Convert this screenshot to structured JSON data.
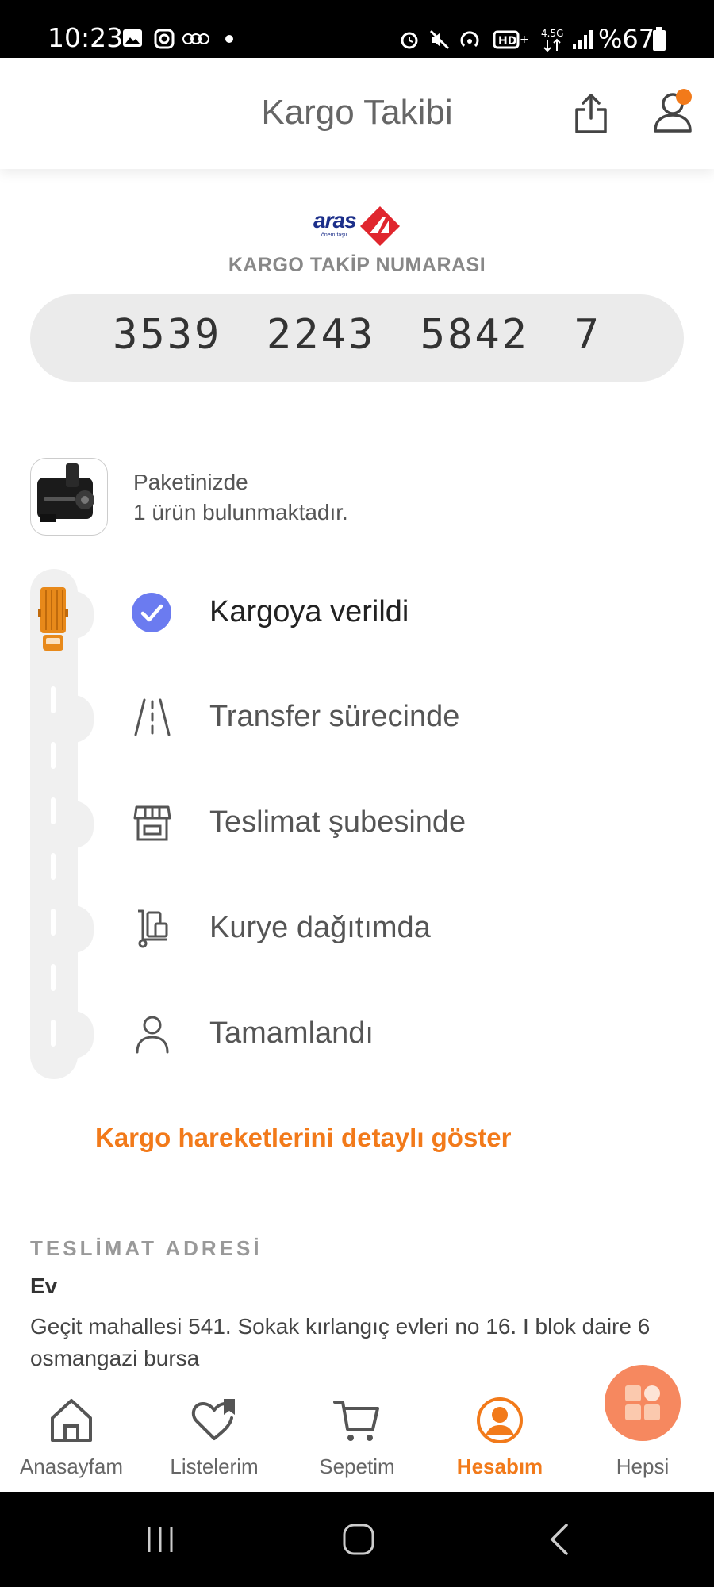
{
  "status_bar": {
    "time": "10:23",
    "battery": "%67",
    "network": "4.5G"
  },
  "header": {
    "title": "Kargo Takibi"
  },
  "carrier": {
    "logo_text": "aras",
    "logo_tagline": "önem taşır",
    "tracking_label": "KARGO TAKİP NUMARASI",
    "tracking_number": "3539  2243  5842  7"
  },
  "package": {
    "line1": "Paketinizde",
    "line2": "1 ürün bulunmaktadır."
  },
  "timeline": {
    "steps": [
      {
        "label": "Kargoya verildi",
        "icon": "check-circle-icon",
        "active": true
      },
      {
        "label": "Transfer sürecinde",
        "icon": "road-icon",
        "active": false
      },
      {
        "label": "Teslimat şubesinde",
        "icon": "store-icon",
        "active": false
      },
      {
        "label": "Kurye dağıtımda",
        "icon": "courier-cart-icon",
        "active": false
      },
      {
        "label": "Tamamlandı",
        "icon": "person-icon",
        "active": false
      }
    ]
  },
  "detail_link": "Kargo hareketlerini detaylı göster",
  "address": {
    "section_label": "TESLİMAT ADRESİ",
    "type": "Ev",
    "text": "Geçit mahallesi 541. Sokak kırlangıç evleri no 16. I blok daire 6 osmangazi bursa"
  },
  "bottom_nav": {
    "items": [
      {
        "label": "Anasayfam",
        "icon": "home-icon"
      },
      {
        "label": "Listelerim",
        "icon": "heart-list-icon"
      },
      {
        "label": "Sepetim",
        "icon": "cart-icon"
      },
      {
        "label": "Hesabım",
        "icon": "account-icon",
        "active": true
      },
      {
        "label": "Hepsi",
        "icon": "grid-icon"
      }
    ]
  },
  "colors": {
    "accent": "#f27a1a",
    "check": "#6b7bf0",
    "truck": "#e8891a",
    "brand_blue": "#1c2f8a",
    "brand_red": "#e0262e"
  }
}
